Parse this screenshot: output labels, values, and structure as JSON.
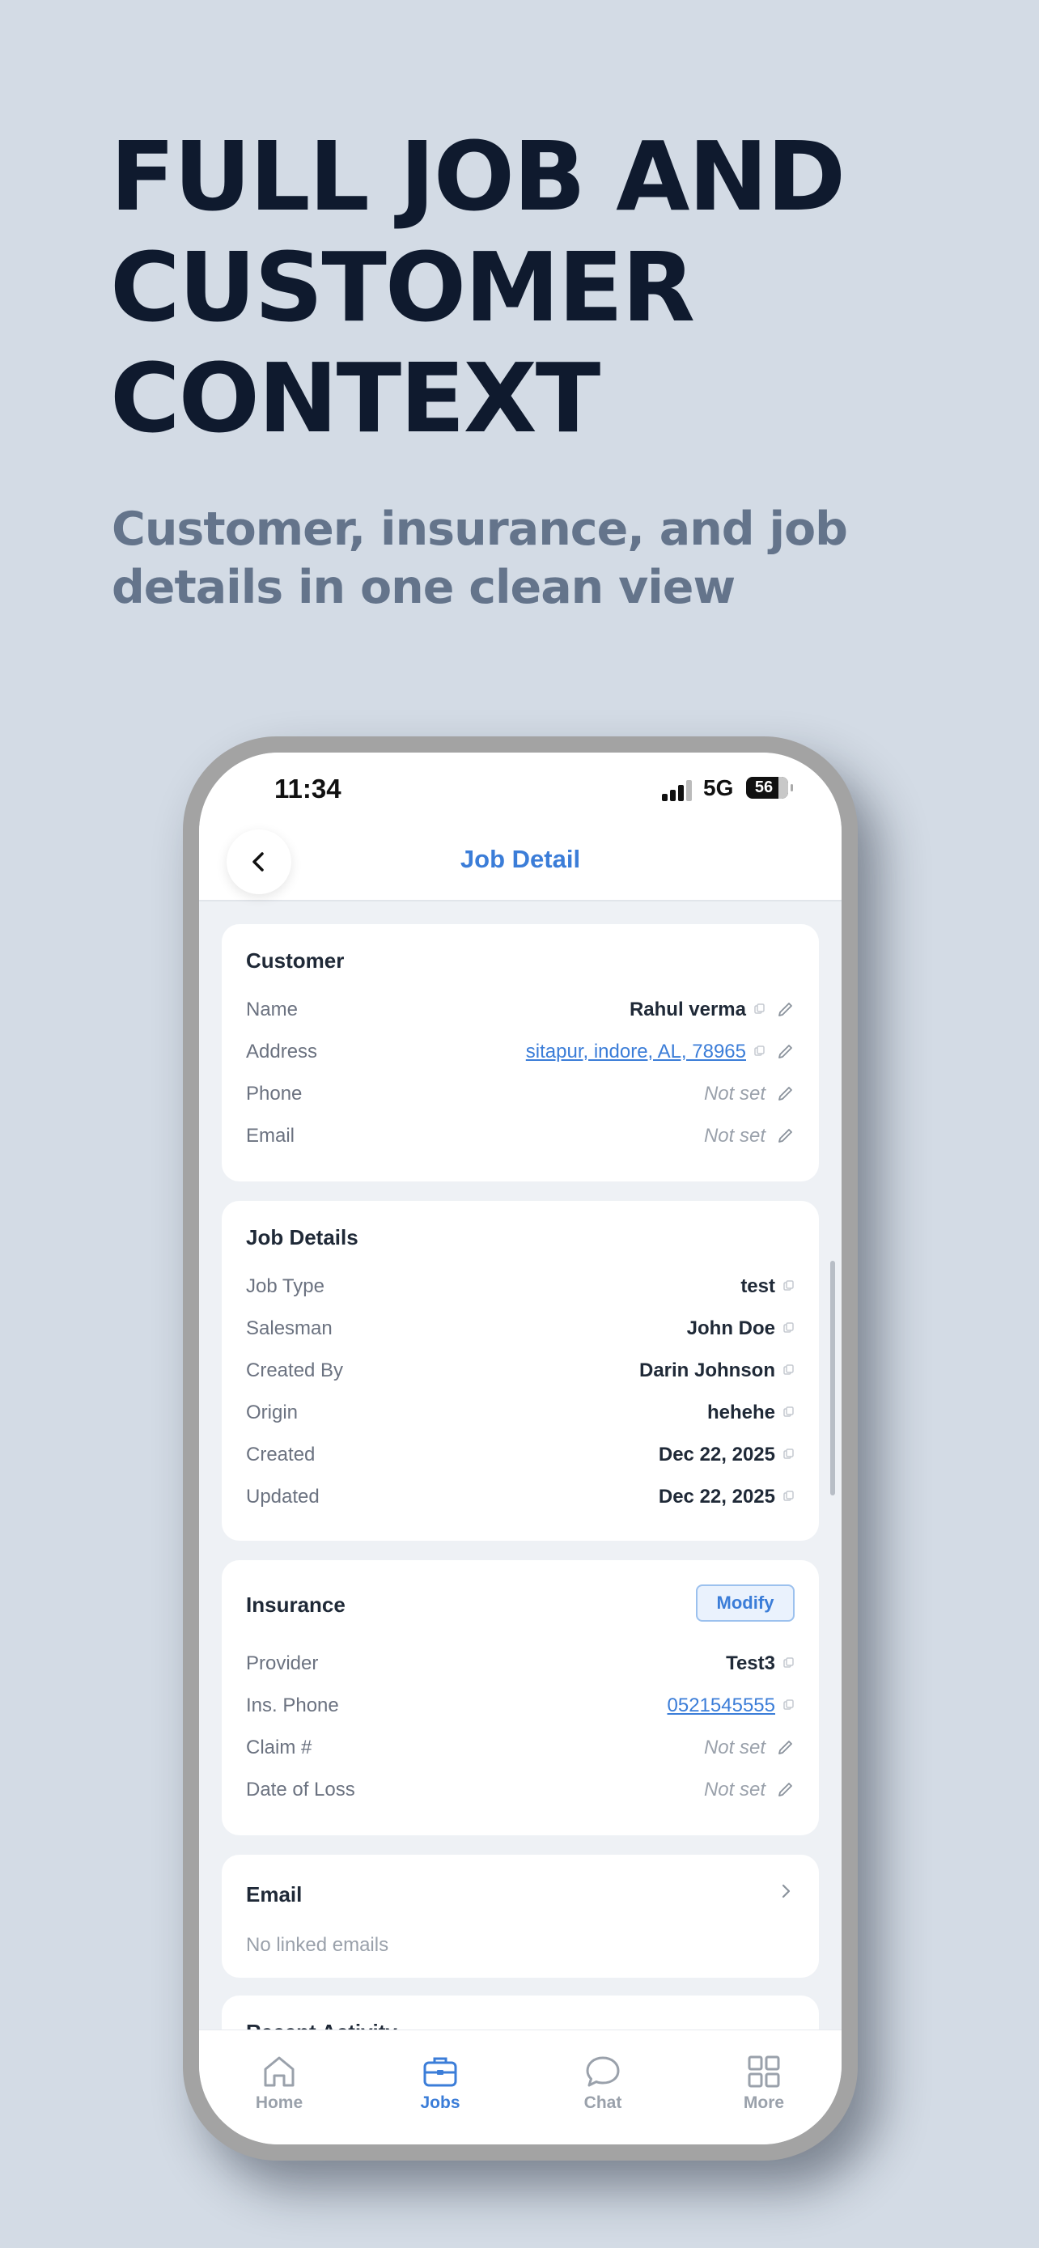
{
  "marketing": {
    "headline": [
      "FULL JOB AND",
      "CUSTOMER",
      "CONTEXT"
    ],
    "subhead": [
      "Customer, insurance, and job",
      "details in one clean view"
    ]
  },
  "status_bar": {
    "time": "11:34",
    "network": "5G",
    "battery": "56"
  },
  "nav": {
    "title": "Job Detail",
    "back_icon": "chevron-left-icon"
  },
  "customer": {
    "title": "Customer",
    "rows": [
      {
        "label": "Name",
        "value": "Rahul verma"
      },
      {
        "label": "Address",
        "value": "sitapur, indore, AL, 78965"
      },
      {
        "label": "Phone",
        "value": "Not set"
      },
      {
        "label": "Email",
        "value": "Not set"
      }
    ]
  },
  "job_details": {
    "title": "Job Details",
    "rows": [
      {
        "label": "Job Type",
        "value": "test"
      },
      {
        "label": "Salesman",
        "value": "John Doe"
      },
      {
        "label": "Created By",
        "value": "Darin Johnson"
      },
      {
        "label": "Origin",
        "value": "hehehe"
      },
      {
        "label": "Created",
        "value": "Dec 22, 2025"
      },
      {
        "label": "Updated",
        "value": "Dec 22, 2025"
      }
    ]
  },
  "insurance": {
    "title": "Insurance",
    "modify_label": "Modify",
    "rows": [
      {
        "label": "Provider",
        "value": "Test3"
      },
      {
        "label": "Ins. Phone",
        "value": "0521545555"
      },
      {
        "label": "Claim #",
        "value": "Not set"
      },
      {
        "label": "Date of Loss",
        "value": "Not set"
      }
    ]
  },
  "email_section": {
    "title": "Email",
    "empty_text": "No linked emails"
  },
  "recent_activity": {
    "title": "Recent Activity"
  },
  "tabs": [
    {
      "label": "Home",
      "icon": "home-icon"
    },
    {
      "label": "Jobs",
      "icon": "briefcase-icon",
      "active": true
    },
    {
      "label": "Chat",
      "icon": "chat-bubble-icon"
    },
    {
      "label": "More",
      "icon": "grid-icon"
    }
  ],
  "colors": {
    "accent": "#3b7dd8",
    "background": "#d3dbe5",
    "headline": "#0f1a2e",
    "subhead": "#64748b"
  }
}
